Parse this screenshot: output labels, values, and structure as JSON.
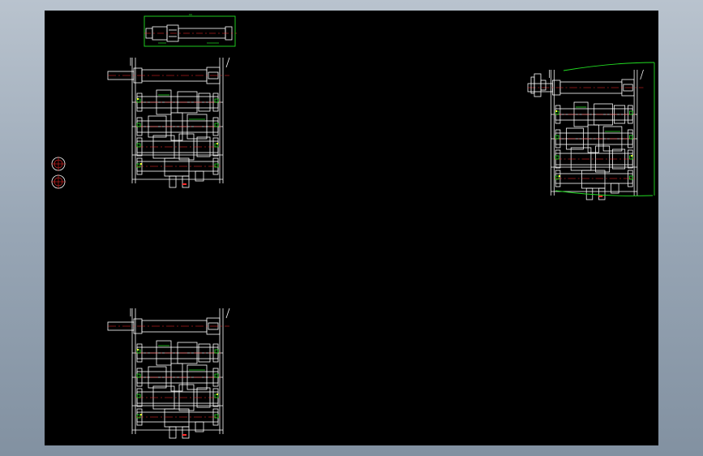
{
  "colors": {
    "background": "#000000",
    "frame": "#aab6c3",
    "line": "#ffffff",
    "center_line": "#ff2a2a",
    "accent": "#22dd22",
    "highlight": "#ffff33"
  },
  "drawing": {
    "views": [
      {
        "id": "assembly-view-top-left",
        "kind": "gearbox-section"
      },
      {
        "id": "assembly-view-bottom-left",
        "kind": "gearbox-section"
      },
      {
        "id": "assembly-view-right",
        "kind": "gearbox-section-with-housing"
      },
      {
        "id": "shaft-detail-top",
        "kind": "shaft-detail"
      },
      {
        "id": "gear-symbol-upper",
        "kind": "gear-symbol"
      },
      {
        "id": "gear-symbol-lower",
        "kind": "gear-symbol"
      }
    ]
  }
}
